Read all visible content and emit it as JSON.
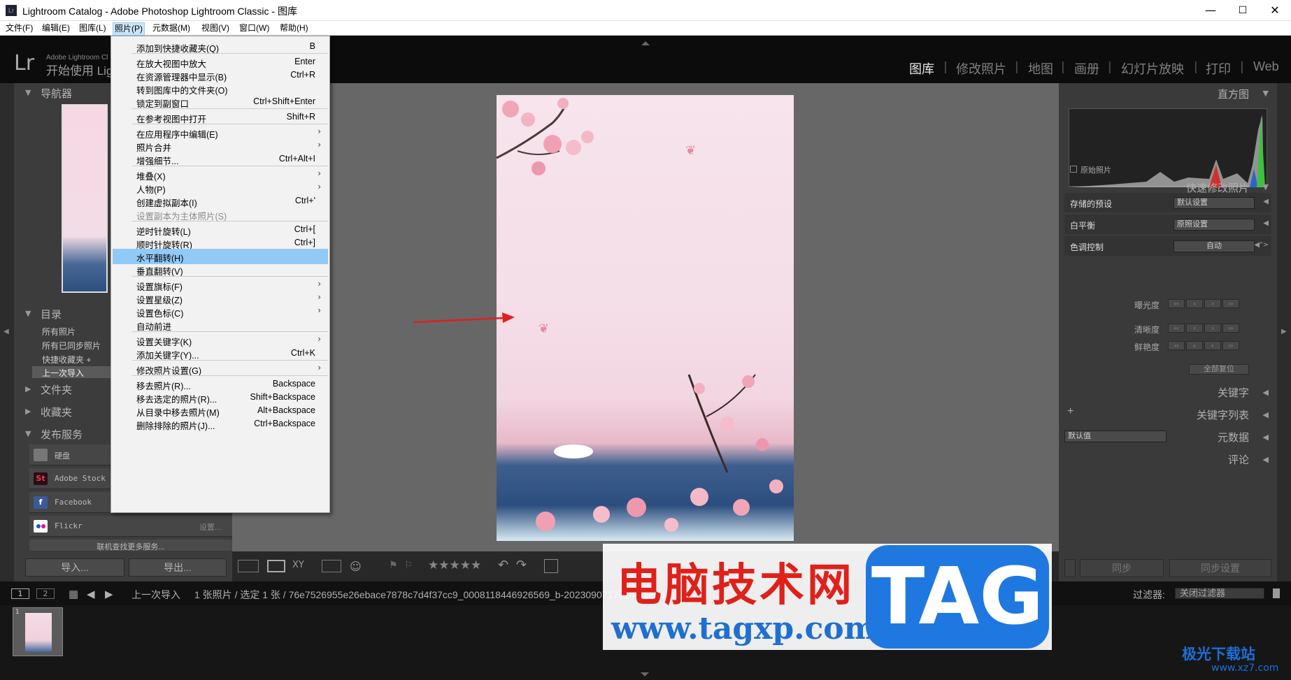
{
  "window": {
    "title": "Lightroom Catalog - Adobe Photoshop Lightroom Classic - 图库",
    "app_icon": "Lr",
    "minimize": "—",
    "maximize": "☐",
    "close": "✕"
  },
  "menubar": [
    "文件(F)",
    "编辑(E)",
    "图库(L)",
    "照片(P)",
    "元数据(M)",
    "视图(V)",
    "窗口(W)",
    "帮助(H)"
  ],
  "header": {
    "logo": "Lr",
    "line1": "Adobe Lightroom Cl",
    "line2": "开始使用 Lig",
    "modules": [
      "图库",
      "修改照片",
      "地图",
      "画册",
      "幻灯片放映",
      "打印",
      "Web"
    ],
    "separator": "|"
  },
  "left": {
    "navigator": "导航器",
    "catalog": "目录",
    "catalog_items": [
      "所有照片",
      "所有已同步照片",
      "快捷收藏夹 +",
      "上一次导入"
    ],
    "folders": "文件夹",
    "collections": "收藏夹",
    "publish": "发布服务",
    "publish_items": [
      {
        "name": "硬盘",
        "status": ""
      },
      {
        "name": "Adobe Stock",
        "status": ""
      },
      {
        "name": "Facebook",
        "status": ""
      },
      {
        "name": "Flickr",
        "status": "设置..."
      }
    ],
    "find_more": "联机查找更多服务...",
    "import_btn": "导入...",
    "export_btn": "导出..."
  },
  "dropdown": [
    {
      "label": "添加到快捷收藏夹(Q)",
      "shortcut": "B"
    },
    {
      "sep": true
    },
    {
      "label": "在放大视图中放大",
      "shortcut": "Enter"
    },
    {
      "label": "在资源管理器中显示(B)",
      "shortcut": "Ctrl+R"
    },
    {
      "label": "转到图库中的文件夹(O)",
      "shortcut": ""
    },
    {
      "label": "锁定到副窗口",
      "shortcut": "Ctrl+Shift+Enter"
    },
    {
      "sep": true
    },
    {
      "label": "在参考视图中打开",
      "shortcut": "Shift+R"
    },
    {
      "sep": true
    },
    {
      "label": "在应用程序中编辑(E)",
      "shortcut": "",
      "sub": true
    },
    {
      "label": "照片合并",
      "shortcut": "",
      "sub": true
    },
    {
      "label": "增强细节...",
      "shortcut": "Ctrl+Alt+I"
    },
    {
      "sep": true
    },
    {
      "label": "堆叠(X)",
      "shortcut": "",
      "sub": true
    },
    {
      "label": "人物(P)",
      "shortcut": "",
      "sub": true
    },
    {
      "label": "创建虚拟副本(I)",
      "shortcut": "Ctrl+'"
    },
    {
      "label": "设置副本为主体照片(S)",
      "shortcut": "",
      "disabled": true
    },
    {
      "sep": true
    },
    {
      "label": "逆时针旋转(L)",
      "shortcut": "Ctrl+["
    },
    {
      "label": "顺时针旋转(R)",
      "shortcut": "Ctrl+]"
    },
    {
      "label": "水平翻转(H)",
      "shortcut": "",
      "highlight": true
    },
    {
      "label": "垂直翻转(V)",
      "shortcut": ""
    },
    {
      "sep": true
    },
    {
      "label": "设置旗标(F)",
      "shortcut": "",
      "sub": true
    },
    {
      "label": "设置星级(Z)",
      "shortcut": "",
      "sub": true
    },
    {
      "label": "设置色标(C)",
      "shortcut": "",
      "sub": true
    },
    {
      "label": "自动前进",
      "shortcut": ""
    },
    {
      "sep": true
    },
    {
      "label": "设置关键字(K)",
      "shortcut": "",
      "sub": true
    },
    {
      "label": "添加关键字(Y)...",
      "shortcut": "Ctrl+K"
    },
    {
      "sep": true
    },
    {
      "label": "修改照片设置(G)",
      "shortcut": "",
      "sub": true
    },
    {
      "sep": true
    },
    {
      "label": "移去照片(R)...",
      "shortcut": "Backspace"
    },
    {
      "label": "移去选定的照片(R)...",
      "shortcut": "Shift+Backspace"
    },
    {
      "label": "从目录中移去照片(M)",
      "shortcut": "Alt+Backspace"
    },
    {
      "label": "删除排除的照片(J)...",
      "shortcut": "Ctrl+Backspace"
    }
  ],
  "right": {
    "histogram": "直方图",
    "original_photo": "原始照片",
    "quick_develop": "快速修改照片",
    "saved_preset": "存储的预设",
    "saved_preset_value": "默认设置",
    "white_balance": "白平衡",
    "white_balance_value": "原照设置",
    "tone_control": "色调控制",
    "auto": "自动",
    "exposure": "曝光度",
    "clarity": "清晰度",
    "vibrance": "鲜艳度",
    "reset_all": "全部复位",
    "keywording": "关键字",
    "keyword_list": "关键字列表",
    "plus": "+",
    "metadata": "元数据",
    "metadata_preset": "默认值",
    "comments": "评论",
    "sync_btn": "同步",
    "sync_settings_btn": "同步设置"
  },
  "filmbar": {
    "view1": "1",
    "view2": "2",
    "source": "上一次导入",
    "info": "1 张照片 / 选定 1 张 / 76e7526955e26ebace7878c7d4f37cc9_0008118446926569_b-20230907170150-x6cpn94.jpg",
    "filter_label": "过滤器:",
    "filter_value": "关闭过滤器"
  },
  "filmstrip": {
    "thumb_index": "1"
  },
  "toolbar": {
    "stars": "★★★★★"
  },
  "watermark": {
    "cn": "电脑技术网",
    "url": "www.tagxp.com",
    "tag": "TAG",
    "corner_cn": "极光下载站",
    "corner_url": "www.xz7.com"
  },
  "colors": {
    "highlight": "#91c9f7",
    "arrow": "#e0201a"
  }
}
